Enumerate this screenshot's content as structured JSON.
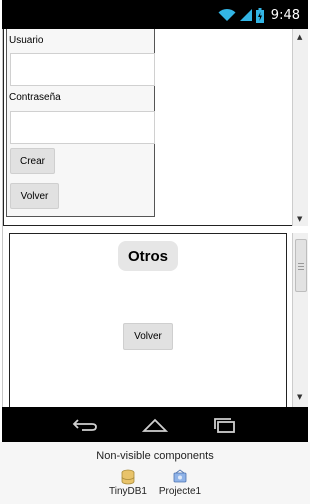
{
  "status_bar": {
    "time": "9:48",
    "icons": [
      "wifi-icon",
      "signal-icon",
      "battery-icon"
    ]
  },
  "form": {
    "username_label": "Usuario",
    "username_value": "",
    "password_label": "Contraseña",
    "password_value": "",
    "create_button": "Crear",
    "back_button": "Volver"
  },
  "others_section": {
    "title": "Otros",
    "back_button": "Volver"
  },
  "nav_bar": {
    "icons": [
      "back-icon",
      "home-icon",
      "recents-icon"
    ]
  },
  "non_visible": {
    "title": "Non-visible components",
    "components": [
      {
        "label": "TinyDB1",
        "icon": "database-icon"
      },
      {
        "label": "Projecte1",
        "icon": "project-icon"
      }
    ]
  }
}
